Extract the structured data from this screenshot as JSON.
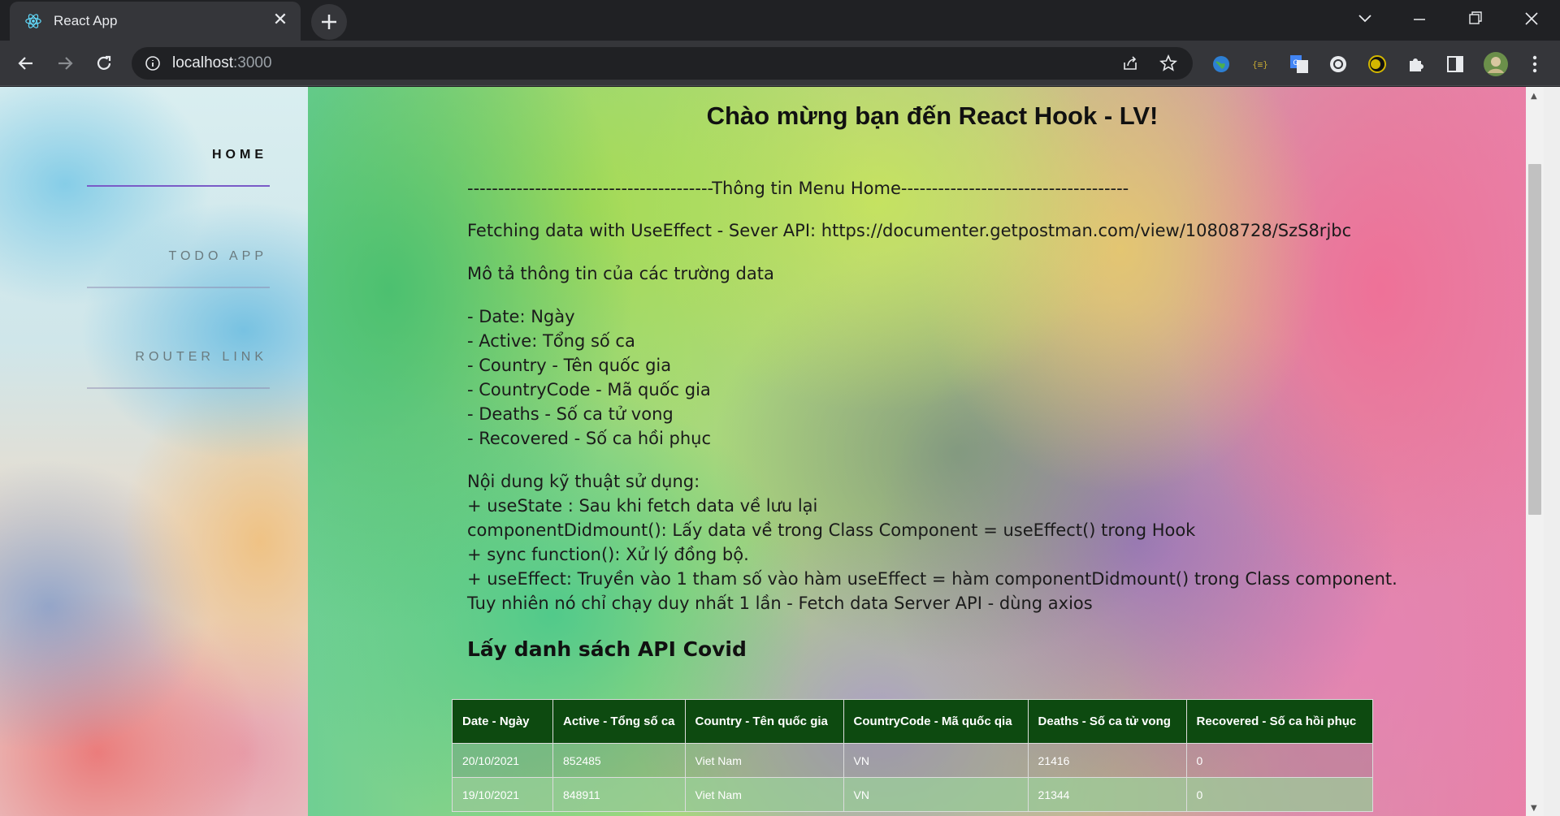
{
  "browser": {
    "tab_title": "React App",
    "url_host": "localhost",
    "url_port": ":3000"
  },
  "sidebar": {
    "items": [
      {
        "label": "HOME",
        "active": true
      },
      {
        "label": "TODO APP",
        "active": false
      },
      {
        "label": "ROUTER LINK",
        "active": false
      }
    ]
  },
  "main": {
    "title": "Chào mừng bạn đến React Hook - LV!",
    "menu_info": "----------------------------------------Thông tin Menu Home-------------------------------------",
    "fetch_line": "Fetching data with UseEffect - Sever API: https://documenter.getpostman.com/view/10808728/SzS8rjbc",
    "fields_intro": "Mô tả thông tin của các trường data",
    "fields": [
      "- Date: Ngày",
      "- Active: Tổng số ca",
      "- Country - Tên quốc gia",
      "- CountryCode - Mã quốc gia",
      "- Deaths - Số ca tử vong",
      "- Recovered - Số ca hồi phục"
    ],
    "tech": [
      "Nội dung kỹ thuật sử dụng:",
      "+ useState : Sau khi fetch data về lưu lại",
      "componentDidmount(): Lấy data về trong Class Component = useEffect() trong Hook",
      "+ sync function(): Xử lý đồng bộ.",
      "+ useEffect: Truyền vào 1 tham số vào hàm useEffect = hàm componentDidmount() trong Class component.",
      "Tuy nhiên nó chỉ chạy duy nhất 1 lần - Fetch data Server API - dùng axios"
    ],
    "section_heading": "Lấy danh sách API Covid",
    "table": {
      "headers": [
        "Date - Ngày",
        "Active - Tổng số ca",
        "Country - Tên quốc gia",
        "CountryCode - Mã quốc qia",
        "Deaths - Số ca tử vong",
        "Recovered - Số ca hồi phục"
      ],
      "rows": [
        [
          "20/10/2021",
          "852485",
          "Viet Nam",
          "VN",
          "21416",
          "0"
        ],
        [
          "19/10/2021",
          "848911",
          "Viet Nam",
          "VN",
          "21344",
          "0"
        ]
      ]
    }
  },
  "colors": {
    "table_header": "#0d4a10",
    "active_underline": "#7a5bc7"
  }
}
